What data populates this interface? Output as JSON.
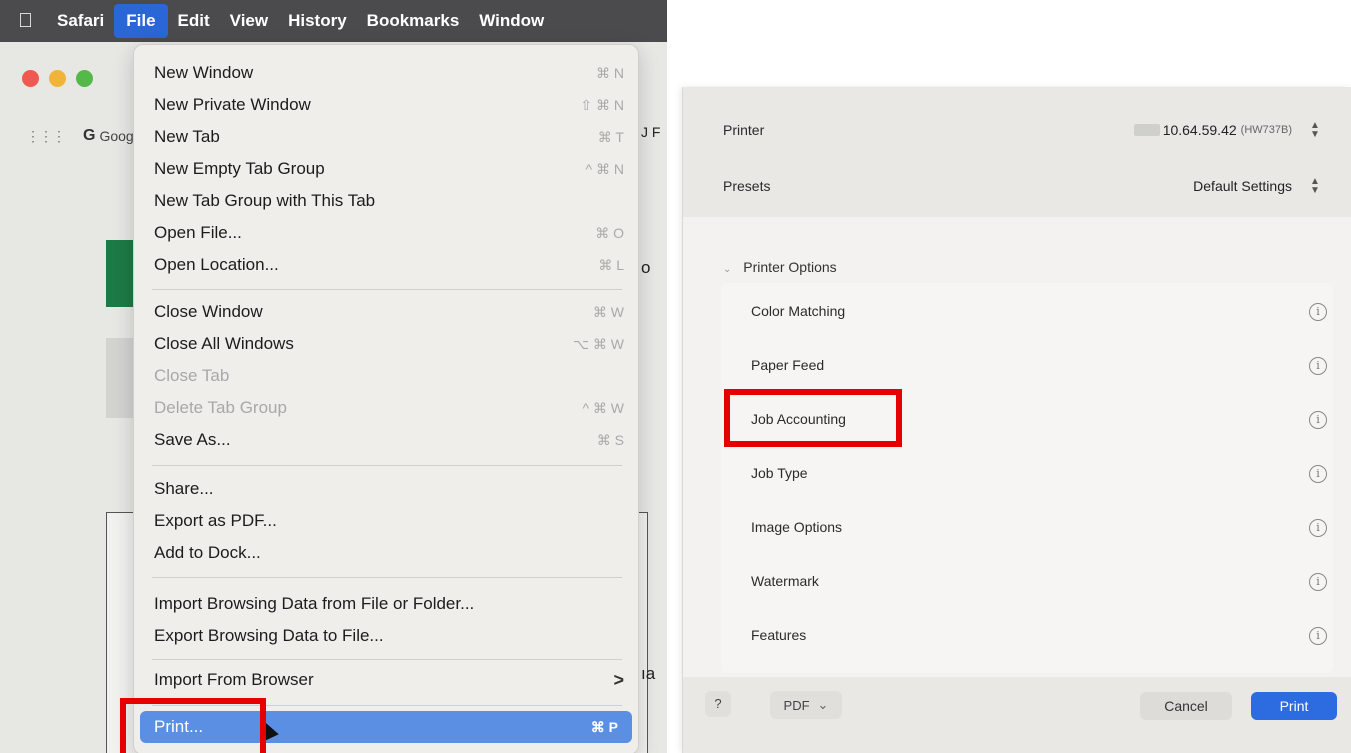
{
  "left": {
    "menubar": {
      "apple_icon": "apple-logo-icon",
      "items": [
        "Safari",
        "File",
        "Edit",
        "View",
        "History",
        "Bookmarks",
        "Window"
      ]
    },
    "bookmarks_bar": {
      "grid_icon": "apps-grid-icon",
      "google_glyph": "G",
      "google_label": "Goog"
    },
    "peek_text": {
      "right_edge_char": "J F",
      "p_char": "o",
      "ha_char": "ıa"
    },
    "file_menu": {
      "items": [
        {
          "label": "New Window",
          "shortcut": "⌘ N"
        },
        {
          "label": "New Private Window",
          "shortcut": "⇧ ⌘ N"
        },
        {
          "label": "New Tab",
          "shortcut": "⌘ T"
        },
        {
          "label": "New Empty Tab Group",
          "shortcut": "^ ⌘ N"
        },
        {
          "label": "New Tab Group with This Tab",
          "shortcut": ""
        },
        {
          "label": "Open File...",
          "shortcut": "⌘ O"
        },
        {
          "label": "Open Location...",
          "shortcut": "⌘ L"
        },
        {
          "label": "Close Window",
          "shortcut": "⌘ W"
        },
        {
          "label": "Close All Windows",
          "shortcut": "⌥ ⌘ W"
        },
        {
          "label": "Close Tab",
          "shortcut": ""
        },
        {
          "label": "Delete Tab Group",
          "shortcut": "^ ⌘ W"
        },
        {
          "label": "Save As...",
          "shortcut": "⌘ S"
        },
        {
          "label": "Share...",
          "shortcut": ""
        },
        {
          "label": "Export as PDF...",
          "shortcut": ""
        },
        {
          "label": "Add to Dock...",
          "shortcut": ""
        },
        {
          "label": "Import Browsing Data from File or Folder...",
          "shortcut": ""
        },
        {
          "label": "Export Browsing Data to File...",
          "shortcut": ""
        },
        {
          "label": "Import From Browser",
          "shortcut": ">"
        },
        {
          "label": "Print...",
          "shortcut": "⌘ P"
        }
      ]
    }
  },
  "right": {
    "printer": {
      "label": "Printer",
      "value": "10.64.59.42",
      "id": "(HW737B)"
    },
    "presets": {
      "label": "Presets",
      "value": "Default Settings"
    },
    "printer_options_header": "Printer Options",
    "options": [
      "Color Matching",
      "Paper Feed",
      "Job Accounting",
      "Job Type",
      "Image Options",
      "Watermark",
      "Features"
    ],
    "info_glyph": "i",
    "footer": {
      "help": "?",
      "pdf": "PDF",
      "pdf_chevron": "⌄",
      "cancel": "Cancel",
      "print": "Print"
    }
  },
  "colors": {
    "menubar_bg": "#4b4b4d",
    "menu_highlight": "#5a8fe4",
    "annotation_red": "#e60000",
    "print_button": "#2c6be0"
  }
}
